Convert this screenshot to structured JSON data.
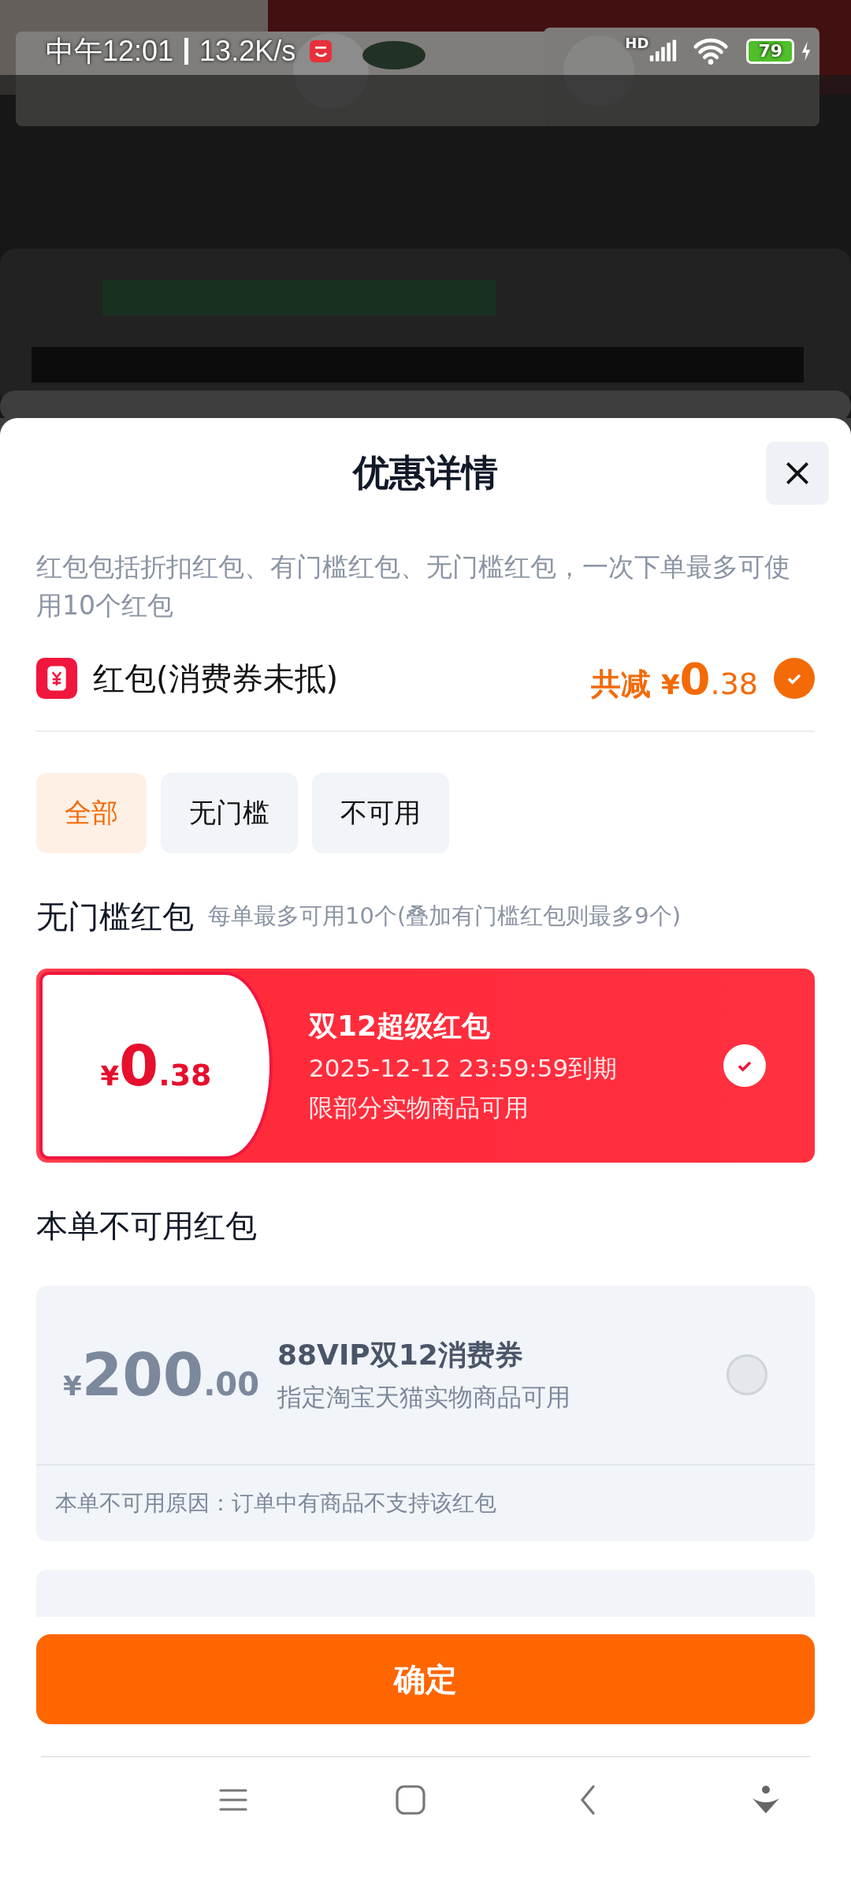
{
  "status_bar": {
    "time": "中午12:01",
    "network_speed": "13.2K/s",
    "network_type": "HD",
    "battery": "79"
  },
  "sheet": {
    "title": "优惠详情",
    "description": "红包包括折扣红包、有门槛红包、无门槛红包，一次下单最多可使用10个红包",
    "summary": {
      "label": "红包(消费券未抵)",
      "total_label": "共减",
      "currency": "¥",
      "amount_int": "0",
      "amount_dec": ".38",
      "checked": true
    },
    "filter_tabs": [
      {
        "label": "全部",
        "selected": true
      },
      {
        "label": "无门槛",
        "selected": false
      },
      {
        "label": "不可用",
        "selected": false
      }
    ],
    "sections": [
      {
        "title": "无门槛红包",
        "note": "每单最多可用10个(叠加有门槛红包则最多9个)",
        "coupons": [
          {
            "kind": "available",
            "currency": "¥",
            "amount_int": "0",
            "amount_dec": ".38",
            "name": "双12超级红包",
            "lines": [
              "2025-12-12 23:59:59到期",
              "限部分实物商品可用"
            ],
            "checked": true
          }
        ]
      },
      {
        "title": "本单不可用红包",
        "coupons": [
          {
            "kind": "unavailable",
            "currency": "¥",
            "amount_int": "200",
            "amount_dec": ".00",
            "name": "88VIP双12消费券",
            "lines": [
              "指定淘宝天猫实物商品可用"
            ],
            "checked": false,
            "reason": "本单不可用原因：订单中有商品不支持该红包"
          },
          {
            "kind": "partial"
          }
        ]
      }
    ],
    "confirm_button": "确定"
  }
}
